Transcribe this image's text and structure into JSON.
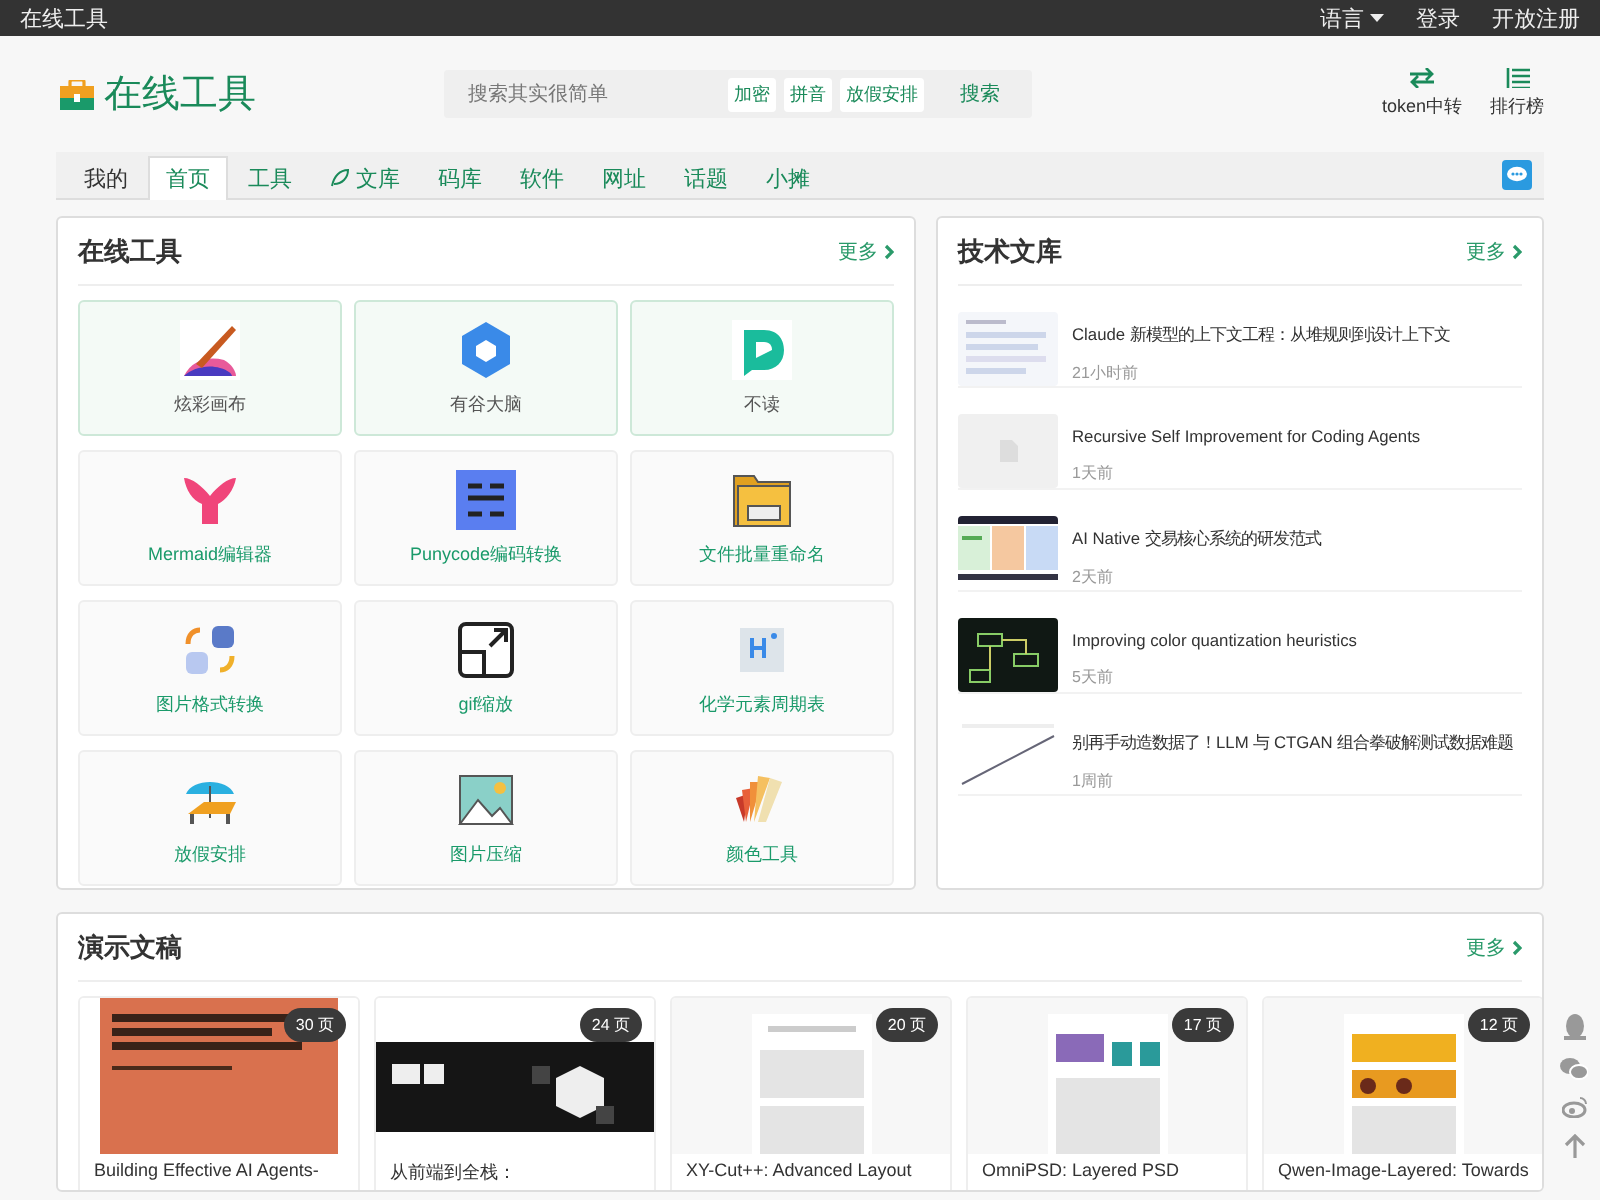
{
  "top_bar": {
    "site": "在线工具",
    "links": [
      {
        "label": "语言",
        "kind": "dropdown"
      },
      {
        "label": "登录",
        "kind": "link"
      },
      {
        "label": "开放注册",
        "kind": "link"
      }
    ]
  },
  "header": {
    "logo": "在线工具",
    "search": {
      "placeholder": "搜索其实很简单",
      "tags": [
        "加密",
        "拼音",
        "放假安排"
      ],
      "button": "搜索"
    },
    "actions": [
      {
        "label": "token中转"
      },
      {
        "label": "排行榜"
      }
    ]
  },
  "tabs": [
    {
      "label": "我的",
      "selected": false
    },
    {
      "label": "首页",
      "selected": true
    },
    {
      "label": "工具",
      "selected": false
    },
    {
      "label": "文库",
      "selected": false
    },
    {
      "label": "码库",
      "selected": false
    },
    {
      "label": "软件",
      "selected": false
    },
    {
      "label": "网址",
      "selected": false
    },
    {
      "label": "话题",
      "selected": false
    },
    {
      "label": "小摊",
      "selected": false
    }
  ],
  "tools_panel": {
    "title": "在线工具",
    "more": "更多",
    "items": [
      {
        "label": "炫彩画布",
        "featured": true
      },
      {
        "label": "有谷大脑",
        "featured": true
      },
      {
        "label": "不读",
        "featured": true
      },
      {
        "label": "Mermaid编辑器",
        "featured": false
      },
      {
        "label": "Punycode编码转换",
        "featured": false
      },
      {
        "label": "文件批量重命名",
        "featured": false
      },
      {
        "label": "图片格式转换",
        "featured": false
      },
      {
        "label": "gif缩放",
        "featured": false
      },
      {
        "label": "化学元素周期表",
        "featured": false
      },
      {
        "label": "放假安排",
        "featured": false
      },
      {
        "label": "图片压缩",
        "featured": false
      },
      {
        "label": "颜色工具",
        "featured": false
      }
    ]
  },
  "library_panel": {
    "title": "技术文库",
    "more": "更多",
    "articles": [
      {
        "title": "Claude 新模型的上下文工程：从堆规则到设计上下文",
        "time": "21小时前",
        "kind": "picture"
      },
      {
        "title": "Recursive Self Improvement for Coding Agents",
        "time": "1天前",
        "kind": "placeholder"
      },
      {
        "title": "AI Native 交易核心系统的研发范式",
        "time": "2天前",
        "kind": "picture"
      },
      {
        "title": "Improving color quantization heuristics",
        "time": "5天前",
        "kind": "picture"
      },
      {
        "title": "别再手动造数据了！LLM 与 CTGAN 组合拳破解测试数据难题",
        "time": "1周前",
        "kind": "picture"
      }
    ]
  },
  "slides_panel": {
    "title": "演示文稿",
    "more": "更多",
    "decks": [
      {
        "title": "Building Effective AI Agents-",
        "pages": "30 页"
      },
      {
        "title": "从前端到全栈：",
        "pages": "24 页"
      },
      {
        "title": "XY-Cut++: Advanced Layout",
        "pages": "20 页"
      },
      {
        "title": "OmniPSD: Layered PSD",
        "pages": "17 页"
      },
      {
        "title": "Qwen-Image-Layered: Towards",
        "pages": "12 页"
      }
    ]
  }
}
